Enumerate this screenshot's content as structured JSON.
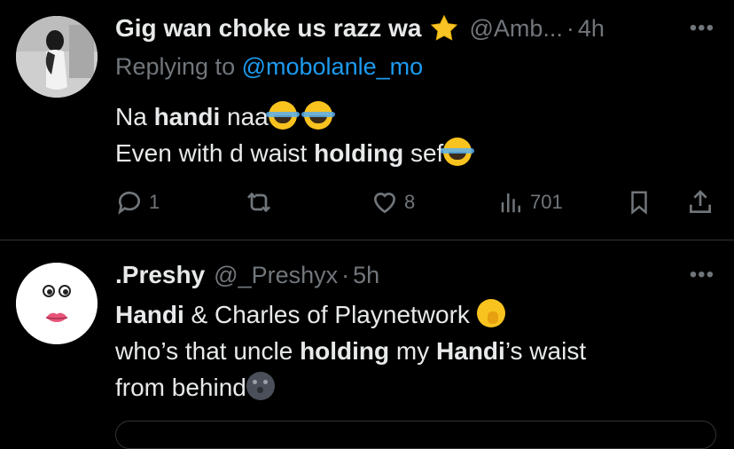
{
  "tweet1": {
    "name": "Gig wan choke us razz wa",
    "handle": "@Amb...",
    "dot": "·",
    "time": "4h",
    "more": "•••",
    "reply_prefix": "Replying to",
    "reply_to": "@mobolanle_mo",
    "line1_a": "Na ",
    "line1_b": "handi",
    "line1_c": " naa",
    "line2_a": "Even with d waist ",
    "line2_b": "holding",
    "line2_c": " sef",
    "replies": "1",
    "likes": "8",
    "views": "701"
  },
  "tweet2": {
    "name": ".Preshy",
    "handle": "@_Preshyx",
    "dot": "·",
    "time": "5h",
    "more": "•••",
    "line1_a": "Handi",
    "line1_b": " & Charles of Playnetwork ",
    "line2_a": "who’s that uncle ",
    "line2_b": "holding",
    "line2_c": " my ",
    "line2_d": "Handi",
    "line2_e": "’s waist",
    "line3_a": "from behind"
  },
  "icons": {
    "verified": "star-badge-icon",
    "reply": "reply-icon",
    "retweet": "retweet-icon",
    "like": "heart-icon",
    "views": "views-icon",
    "bookmark": "bookmark-icon",
    "share": "share-icon"
  },
  "colors": {
    "background": "#000000",
    "text": "#e7e9ea",
    "muted": "#71767b",
    "link": "#1d9bf0",
    "divider": "#2f3336",
    "star": "#f7c325"
  }
}
